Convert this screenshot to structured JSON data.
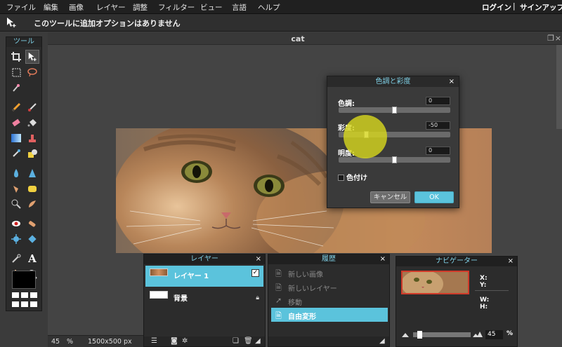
{
  "menubar": {
    "items": [
      "ファイル",
      "編集",
      "画像",
      "レイヤー",
      "調整",
      "フィルター",
      "ビュー",
      "言語",
      "ヘルプ"
    ],
    "login": "ログイン",
    "separator": "|",
    "signup": "サインアップ"
  },
  "options_bar": {
    "message": "このツールに追加オプションはありません"
  },
  "toolbox": {
    "title": "ツール",
    "text_tool_glyph": "A"
  },
  "document": {
    "title": "cat"
  },
  "status": {
    "zoom": "45",
    "zoom_unit": "%",
    "size": "1500x500 px"
  },
  "dialog": {
    "title": "色調と彩度",
    "close": "×",
    "hue_label": "色調:",
    "hue_value": "0",
    "saturation_label": "彩度:",
    "saturation_value": "-50",
    "lightness_label": "明度:",
    "lightness_value": "0",
    "colorize_label": "色付け",
    "cancel_label": "キャンセル",
    "ok_label": "OK"
  },
  "layers": {
    "title": "レイヤー",
    "close": "×",
    "items": [
      {
        "name": "レイヤー 1",
        "selected": true
      },
      {
        "name": "背景",
        "selected": false
      }
    ]
  },
  "history": {
    "title": "履歴",
    "close": "×",
    "items": [
      {
        "label": "新しい画像"
      },
      {
        "label": "新しいレイヤー"
      },
      {
        "label": "移動"
      },
      {
        "label": "自由変形"
      }
    ]
  },
  "navigator": {
    "title": "ナビゲーター",
    "close": "×",
    "x_label": "X:",
    "y_label": "Y:",
    "w_label": "W:",
    "h_label": "H:",
    "zoom": "45",
    "zoom_unit": "%"
  },
  "colors": {
    "accent": "#5bc3dc",
    "highlight": "#d6d61e",
    "menubar_bg": "#202020"
  }
}
